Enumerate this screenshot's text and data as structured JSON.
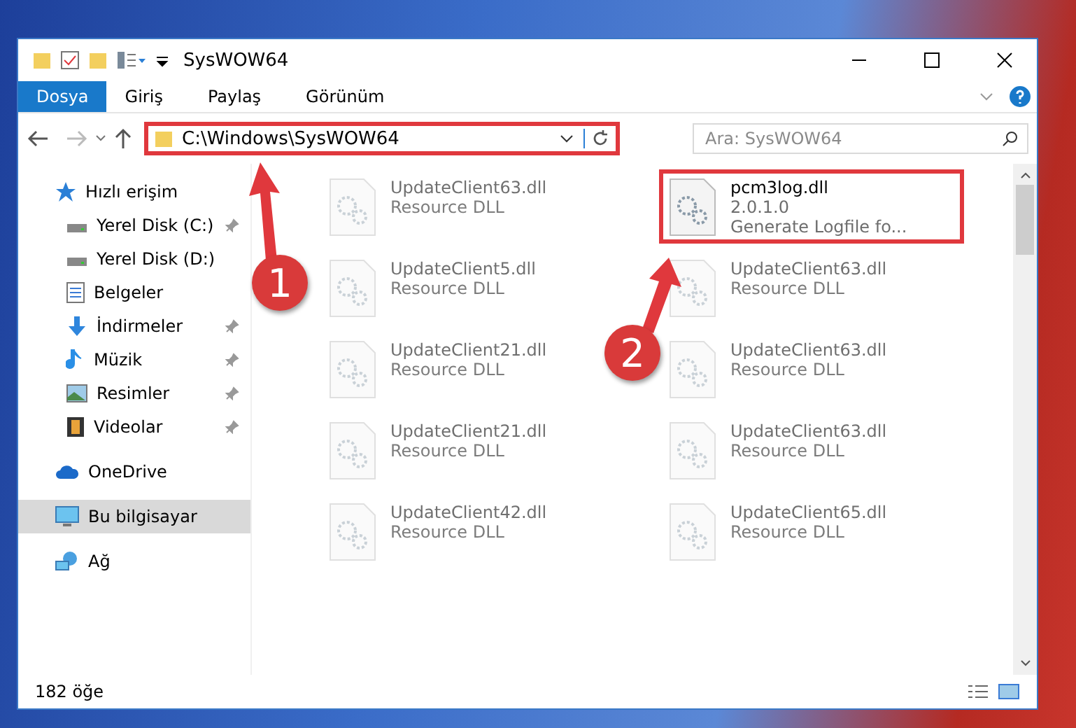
{
  "window": {
    "title": "SysWOW64"
  },
  "ribbon_tabs": [
    {
      "label": "Dosya",
      "selected": true
    },
    {
      "label": "Giriş",
      "selected": false
    },
    {
      "label": "Paylaş",
      "selected": false
    },
    {
      "label": "Görünüm",
      "selected": false
    }
  ],
  "address": {
    "path": "C:\\Windows\\SysWOW64",
    "highlighted": true
  },
  "search": {
    "placeholder": "Ara: SysWOW64"
  },
  "sidebar": {
    "items": [
      {
        "label": "Hızlı erişim",
        "kind": "star",
        "pinned": false,
        "selected": false,
        "indent": false
      },
      {
        "label": "Yerel Disk (C:)",
        "kind": "drive",
        "pinned": true,
        "selected": false,
        "indent": true
      },
      {
        "label": "Yerel Disk (D:)",
        "kind": "drive",
        "pinned": false,
        "selected": false,
        "indent": true
      },
      {
        "label": "Belgeler",
        "kind": "doc",
        "pinned": false,
        "selected": false,
        "indent": true
      },
      {
        "label": "İndirmeler",
        "kind": "download",
        "pinned": true,
        "selected": false,
        "indent": true
      },
      {
        "label": "Müzik",
        "kind": "music",
        "pinned": true,
        "selected": false,
        "indent": true
      },
      {
        "label": "Resimler",
        "kind": "picture",
        "pinned": true,
        "selected": false,
        "indent": true
      },
      {
        "label": "Videolar",
        "kind": "video",
        "pinned": true,
        "selected": false,
        "indent": true
      },
      {
        "label": "OneDrive",
        "kind": "cloud",
        "pinned": false,
        "selected": false,
        "indent": false
      },
      {
        "label": "Bu bilgisayar",
        "kind": "computer",
        "pinned": false,
        "selected": true,
        "indent": false
      },
      {
        "label": "Ağ",
        "kind": "network",
        "pinned": false,
        "selected": false,
        "indent": false
      }
    ]
  },
  "files": [
    {
      "name": "UpdateClient63.dll",
      "line_2": "Resource DLL",
      "blurred": true,
      "highlighted": false
    },
    {
      "name": "pcm3log.dll",
      "line_2": "2.0.1.0",
      "line_3": "Generate Logfile fo...",
      "blurred": false,
      "highlighted": true
    },
    {
      "name": "UpdateClient5.dll",
      "line_2": "Resource DLL",
      "blurred": true,
      "highlighted": false
    },
    {
      "name": "UpdateClient63.dll",
      "line_2": "Resource DLL",
      "blurred": true,
      "highlighted": false
    },
    {
      "name": "UpdateClient21.dll",
      "line_2": "Resource DLL",
      "blurred": true,
      "highlighted": false
    },
    {
      "name": "UpdateClient63.dll",
      "line_2": "Resource DLL",
      "blurred": true,
      "highlighted": false
    },
    {
      "name": "UpdateClient21.dll",
      "line_2": "Resource DLL",
      "blurred": true,
      "highlighted": false
    },
    {
      "name": "UpdateClient63.dll",
      "line_2": "Resource DLL",
      "blurred": true,
      "highlighted": false
    },
    {
      "name": "UpdateClient42.dll",
      "line_2": "Resource DLL",
      "blurred": true,
      "highlighted": false
    },
    {
      "name": "UpdateClient65.dll",
      "line_2": "Resource DLL",
      "blurred": true,
      "highlighted": false
    }
  ],
  "status_bar": {
    "count": "182 öğe"
  },
  "annotations": [
    {
      "number": "1"
    },
    {
      "number": "2"
    }
  ]
}
